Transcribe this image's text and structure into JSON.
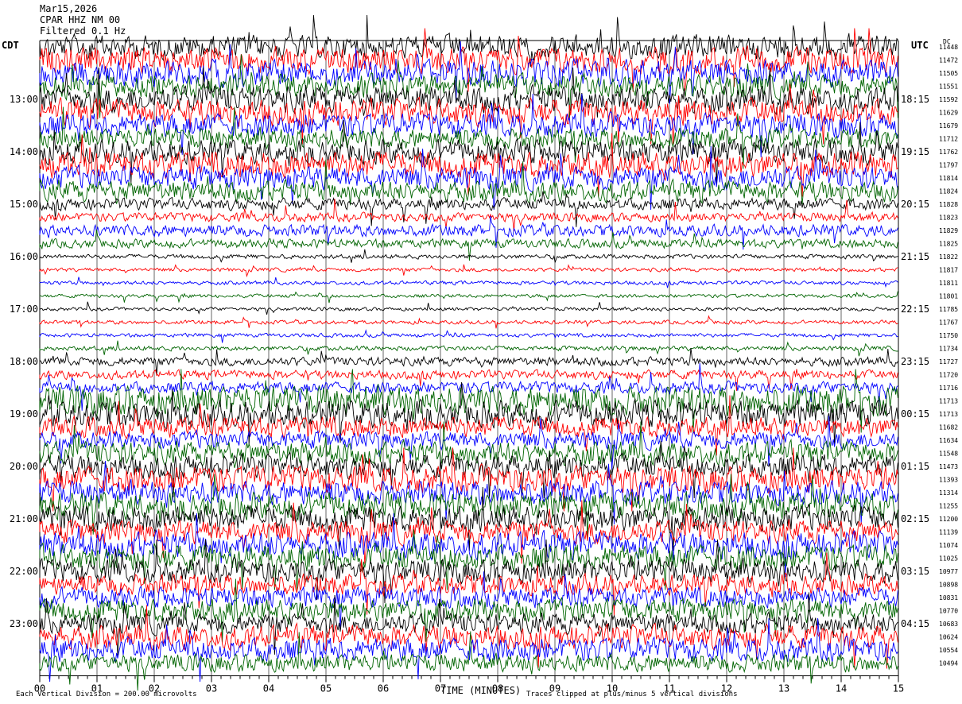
{
  "header": {
    "date": "Mar15,2026",
    "station": "CPAR HHZ NM 00",
    "filter": "Filtered 0.1 Hz"
  },
  "left_tz_label": "CDT",
  "right_tz_label": "UTC",
  "dc_label": "DC",
  "colors": {
    "trace_cycle": [
      "#000000",
      "#ff0000",
      "#0000ff",
      "#006400"
    ],
    "background": "#ffffff",
    "grid": "#000000"
  },
  "footer": {
    "scale_note": "Each Vertical Division =  200.00 microvolts",
    "clip_note": "Traces clipped at plus/minus 5 vertical divisions"
  },
  "chart_data": {
    "type": "line",
    "xlabel": "TIME (MINUTES)",
    "x_ticks": [
      "00",
      "01",
      "02",
      "03",
      "04",
      "05",
      "06",
      "07",
      "08",
      "09",
      "10",
      "11",
      "12",
      "13",
      "14",
      "15"
    ],
    "xlim": [
      0,
      15
    ],
    "left_hour_labels": [
      "13:00",
      "14:00",
      "15:00",
      "16:00",
      "17:00",
      "18:00",
      "19:00",
      "20:00",
      "21:00",
      "22:00",
      "23:00"
    ],
    "right_hour_labels": [
      "18:15",
      "19:15",
      "20:15",
      "21:15",
      "22:15",
      "23:15",
      "00:15",
      "01:15",
      "02:15",
      "03:15",
      "04:15"
    ],
    "dc_offsets": [
      11448,
      11472,
      11505,
      11551,
      11592,
      11629,
      11679,
      11712,
      11762,
      11797,
      11814,
      11824,
      11828,
      11823,
      11829,
      11825,
      11822,
      11817,
      11811,
      11801,
      11785,
      11767,
      11750,
      11734,
      11727,
      11720,
      11716,
      11713,
      11713,
      11682,
      11634,
      11548,
      11473,
      11393,
      11314,
      11255,
      11200,
      11139,
      11074,
      11025,
      10977,
      10898,
      10831,
      10770,
      10683,
      10624,
      10554,
      10494
    ],
    "trace_activity": [
      8,
      9,
      9,
      8,
      9,
      9,
      8,
      7,
      8,
      9,
      8,
      7,
      4,
      3,
      4,
      3,
      1.5,
      1.3,
      1.3,
      1.2,
      1.2,
      1.3,
      1.3,
      1.6,
      3,
      3,
      4,
      10,
      9,
      7,
      6,
      8,
      8,
      9,
      8,
      9,
      9,
      8,
      9,
      9,
      8,
      7,
      7,
      8,
      7,
      8,
      8,
      6
    ]
  }
}
